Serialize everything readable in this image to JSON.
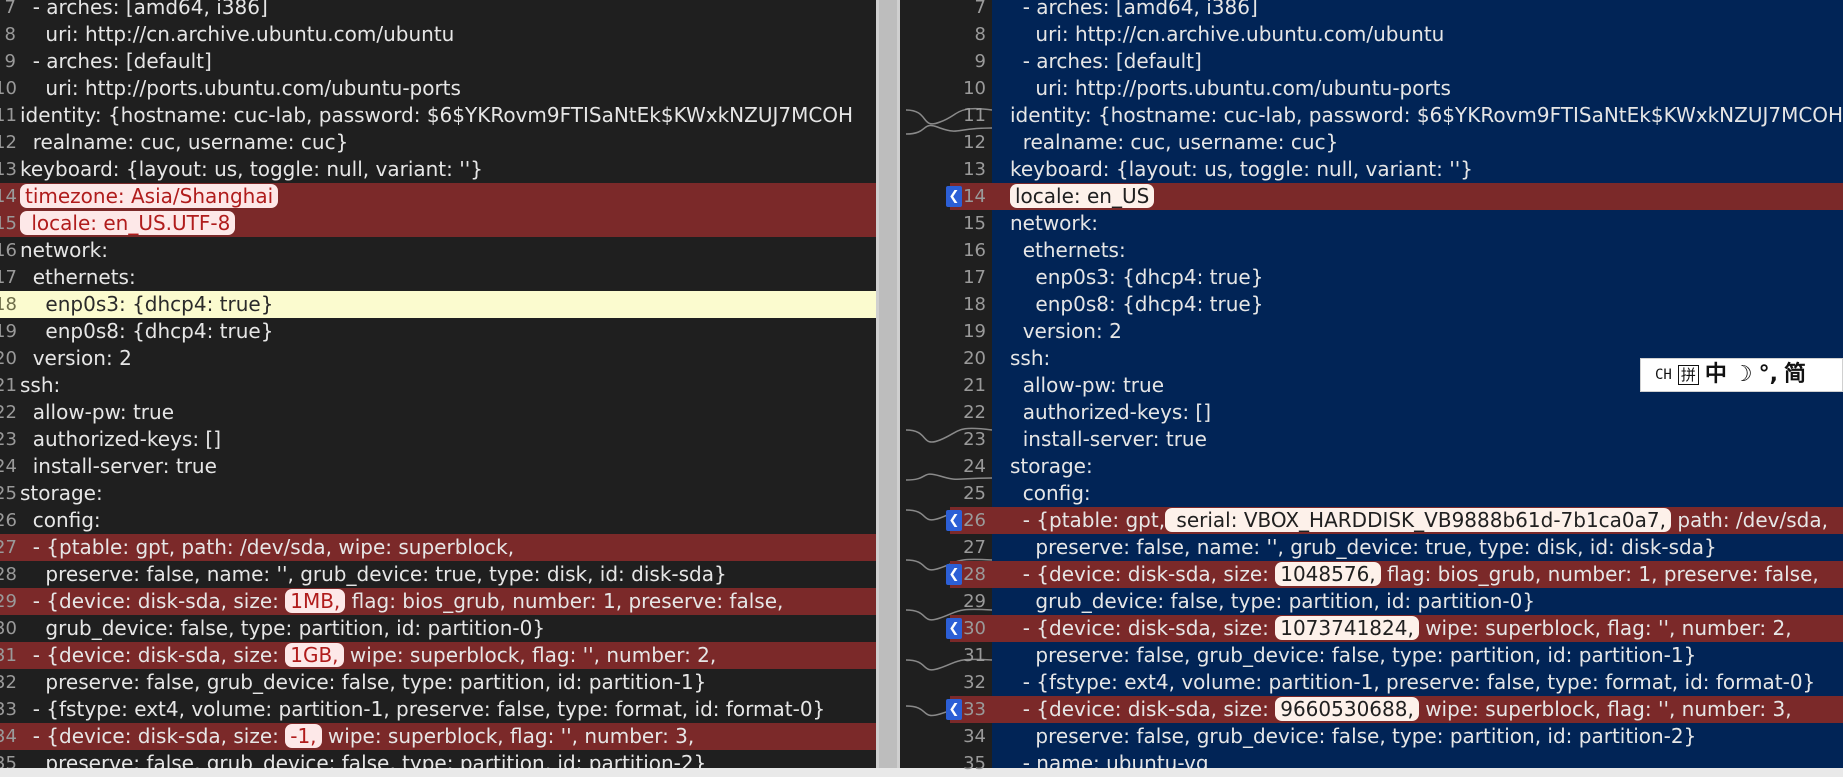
{
  "left": {
    "lines": [
      {
        "n": "7",
        "t": "  - arches: [amd64, i386]"
      },
      {
        "n": "8",
        "t": "    uri: http://cn.archive.ubuntu.com/ubuntu"
      },
      {
        "n": "9",
        "t": "  - arches: [default]"
      },
      {
        "n": "10",
        "t": "    uri: http://ports.ubuntu.com/ubuntu-ports"
      },
      {
        "n": "11",
        "t": "identity: {hostname: cuc-lab, password: $6$YKRovm9FTISaNtEk$KWxkNZUJ7MCOH"
      },
      {
        "n": "12",
        "t": "  realname: cuc, username: cuc}"
      },
      {
        "n": "13",
        "t": "keyboard: {layout: us, toggle: null, variant: ''}"
      },
      {
        "n": "14",
        "hl": "timezone: Asia/Shanghai",
        "kind": "del"
      },
      {
        "n": "15",
        "hl": " locale: en_US.UTF-8",
        "kind": "del"
      },
      {
        "n": "16",
        "t": "network:"
      },
      {
        "n": "17",
        "t": "  ethernets:"
      },
      {
        "n": "18",
        "t": "    enp0s3: {dhcp4: true}",
        "kind": "cur"
      },
      {
        "n": "19",
        "t": "    enp0s8: {dhcp4: true}"
      },
      {
        "n": "20",
        "t": "  version: 2"
      },
      {
        "n": "21",
        "t": "ssh:"
      },
      {
        "n": "22",
        "t": "  allow-pw: true"
      },
      {
        "n": "23",
        "t": "  authorized-keys: []"
      },
      {
        "n": "24",
        "t": "  install-server: true"
      },
      {
        "n": "25",
        "t": "storage:"
      },
      {
        "n": "26",
        "t": "  config:"
      },
      {
        "n": "27",
        "t": "  - {ptable: gpt, path: /dev/sda, wipe: superblock,",
        "kind": "del"
      },
      {
        "n": "28",
        "t": "    preserve: false, name: '', grub_device: true, type: disk, id: disk-sda}"
      },
      {
        "n": "29",
        "pre": "  - {device: disk-sda, size: ",
        "hl": "1MB,",
        "post": " flag: bios_grub, number: 1, preserve: false,",
        "kind": "del"
      },
      {
        "n": "30",
        "t": "    grub_device: false, type: partition, id: partition-0}"
      },
      {
        "n": "31",
        "pre": "  - {device: disk-sda, size: ",
        "hl": "1GB,",
        "post": " wipe: superblock, flag: '', number: 2,",
        "kind": "del"
      },
      {
        "n": "32",
        "t": "    preserve: false, grub_device: false, type: partition, id: partition-1}"
      },
      {
        "n": "33",
        "t": "  - {fstype: ext4, volume: partition-1, preserve: false, type: format, id: format-0}"
      },
      {
        "n": "34",
        "pre": "  - {device: disk-sda, size: ",
        "hl": "-1,",
        "post": " wipe: superblock, flag: '', number: 3,",
        "kind": "del"
      },
      {
        "n": "35",
        "t": "    preserve: false, grub_device: false, type: partition, id: partition-2}"
      }
    ]
  },
  "right": {
    "lines": [
      {
        "n": "7",
        "t": "  - arches: [amd64, i386]"
      },
      {
        "n": "8",
        "t": "    uri: http://cn.archive.ubuntu.com/ubuntu"
      },
      {
        "n": "9",
        "t": "  - arches: [default]"
      },
      {
        "n": "10",
        "t": "    uri: http://ports.ubuntu.com/ubuntu-ports"
      },
      {
        "n": "11",
        "t": "identity: {hostname: cuc-lab, password: $6$YKRovm9FTISaNtEk$KWxkNZUJ7MCOH"
      },
      {
        "n": "12",
        "t": "  realname: cuc, username: cuc}"
      },
      {
        "n": "13",
        "t": "keyboard: {layout: us, toggle: null, variant: ''}"
      },
      {
        "n": "14",
        "hl": "locale: en_US",
        "kind": "del",
        "arrow": true
      },
      {
        "n": "15",
        "t": "network:"
      },
      {
        "n": "16",
        "t": "  ethernets:"
      },
      {
        "n": "17",
        "t": "    enp0s3: {dhcp4: true}"
      },
      {
        "n": "18",
        "t": "    enp0s8: {dhcp4: true}"
      },
      {
        "n": "19",
        "t": "  version: 2"
      },
      {
        "n": "20",
        "t": "ssh:"
      },
      {
        "n": "21",
        "t": "  allow-pw: true"
      },
      {
        "n": "22",
        "t": "  authorized-keys: []"
      },
      {
        "n": "23",
        "t": "  install-server: true"
      },
      {
        "n": "24",
        "t": "storage:"
      },
      {
        "n": "25",
        "t": "  config:"
      },
      {
        "n": "26",
        "pre": "  - {ptable: gpt,",
        "hl": " serial: VBOX_HARDDISK_VB9888b61d-7b1ca0a7,",
        "post": " path: /dev/sda,",
        "kind": "del",
        "arrow": true
      },
      {
        "n": "27",
        "t": "    preserve: false, name: '', grub_device: true, type: disk, id: disk-sda}"
      },
      {
        "n": "28",
        "pre": "  - {device: disk-sda, size: ",
        "hl": "1048576,",
        "post": " flag: bios_grub, number: 1, preserve: false,",
        "kind": "del",
        "arrow": true
      },
      {
        "n": "29",
        "t": "    grub_device: false, type: partition, id: partition-0}"
      },
      {
        "n": "30",
        "pre": "  - {device: disk-sda, size: ",
        "hl": "1073741824,",
        "post": " wipe: superblock, flag: '', number: 2,",
        "kind": "del",
        "arrow": true
      },
      {
        "n": "31",
        "t": "    preserve: false, grub_device: false, type: partition, id: partition-1}"
      },
      {
        "n": "32",
        "t": "  - {fstype: ext4, volume: partition-1, preserve: false, type: format, id: format-0}"
      },
      {
        "n": "33",
        "pre": "  - {device: disk-sda, size: ",
        "hl": "9660530688,",
        "post": " wipe: superblock, flag: '', number: 3,",
        "kind": "del",
        "arrow": true
      },
      {
        "n": "34",
        "t": "    preserve: false, grub_device: false, type: partition, id: partition-2}"
      },
      {
        "n": "35",
        "t": "  - name: ubuntu-vg"
      }
    ]
  },
  "ime": {
    "mode": "CH",
    "pinyin": "拼",
    "lang": "中",
    "moon": "☽",
    "punct": "°,",
    "simplified": "简"
  },
  "colors": {
    "left_bg": "#1f1f1f",
    "right_bg": "#012456",
    "diff_bg": "#7b2929",
    "current_line_bg": "#fbfbcf",
    "arrow": "#2c5fd6"
  }
}
